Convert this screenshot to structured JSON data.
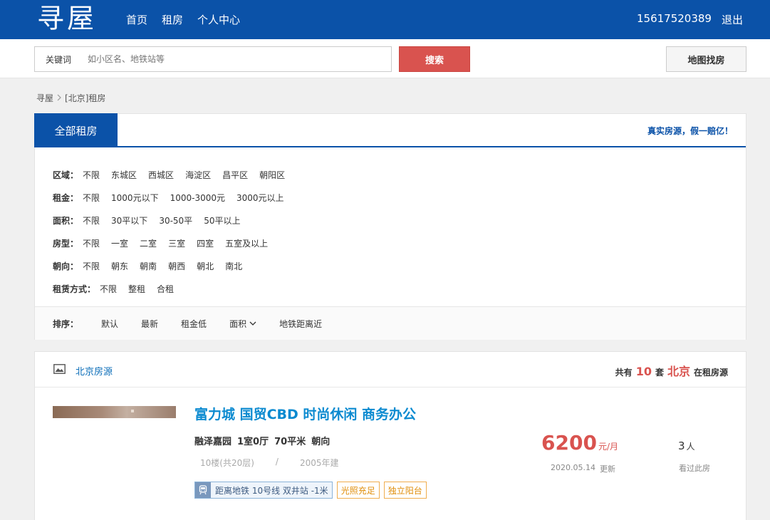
{
  "header": {
    "logo": "寻屋",
    "nav": [
      "首页",
      "租房",
      "个人中心"
    ],
    "phone": "15617520389",
    "logout": "退出"
  },
  "search": {
    "keyword_label": "关键词",
    "placeholder": "如小区名、地铁站等",
    "search_button": "搜索",
    "map_button": "地图找房"
  },
  "breadcrumb": {
    "home": "寻屋",
    "current": "[北京]租房"
  },
  "filter_panel": {
    "tab": "全部租房",
    "slogan": "真实房源，假一赔亿！",
    "rows": [
      {
        "label": "区域：",
        "options": [
          "不限",
          "东城区",
          "西城区",
          "海淀区",
          "昌平区",
          "朝阳区"
        ]
      },
      {
        "label": "租金：",
        "options": [
          "不限",
          "1000元以下",
          "1000-3000元",
          "3000元以上"
        ]
      },
      {
        "label": "面积：",
        "options": [
          "不限",
          "30平以下",
          "30-50平",
          "50平以上"
        ]
      },
      {
        "label": "房型：",
        "options": [
          "不限",
          "一室",
          "二室",
          "三室",
          "四室",
          "五室及以上"
        ]
      },
      {
        "label": "朝向：",
        "options": [
          "不限",
          "朝东",
          "朝南",
          "朝西",
          "朝北",
          "南北"
        ]
      },
      {
        "label": "租赁方式：",
        "options": [
          "不限",
          "整租",
          "合租"
        ]
      }
    ],
    "sort": {
      "label": "排序：",
      "options": [
        "默认",
        "最新",
        "租金低",
        "面积",
        "地铁距离近"
      ]
    }
  },
  "listing": {
    "header_title": "北京房源",
    "count_prefix": "共有",
    "count": "10",
    "count_unit": "套",
    "city": "北京",
    "count_suffix": "在租房源",
    "items": [
      {
        "title": "富力城 国贸CBD 时尚休闲 商务办公",
        "community": "融泽嘉园",
        "layout": "1室0厅",
        "area": "70平米",
        "orientation": "朝向",
        "floor": "10楼(共20层)",
        "divider": "/",
        "built": "2005年建",
        "metro_tag": "距离地铁 10号线 双井站 -1米",
        "tags": [
          "光照充足",
          "独立阳台"
        ],
        "price": "6200",
        "price_unit": "元/月",
        "update_date": "2020.05.14",
        "update_label": "更新",
        "viewers": "3",
        "viewers_unit": "人",
        "viewers_label": "看过此房"
      }
    ]
  },
  "colors": {
    "brand_blue": "#0b52a8",
    "search_red": "#d9534f",
    "price_red": "#d9534f",
    "title_blue": "#0b8ad0",
    "tag_orange": "#f0ad4e"
  },
  "icons": {
    "image_icon": "image-icon",
    "metro_icon": "subway-icon",
    "chevron": "chevron-down-icon",
    "breadcrumb_sep": "chevron-right-icon"
  }
}
